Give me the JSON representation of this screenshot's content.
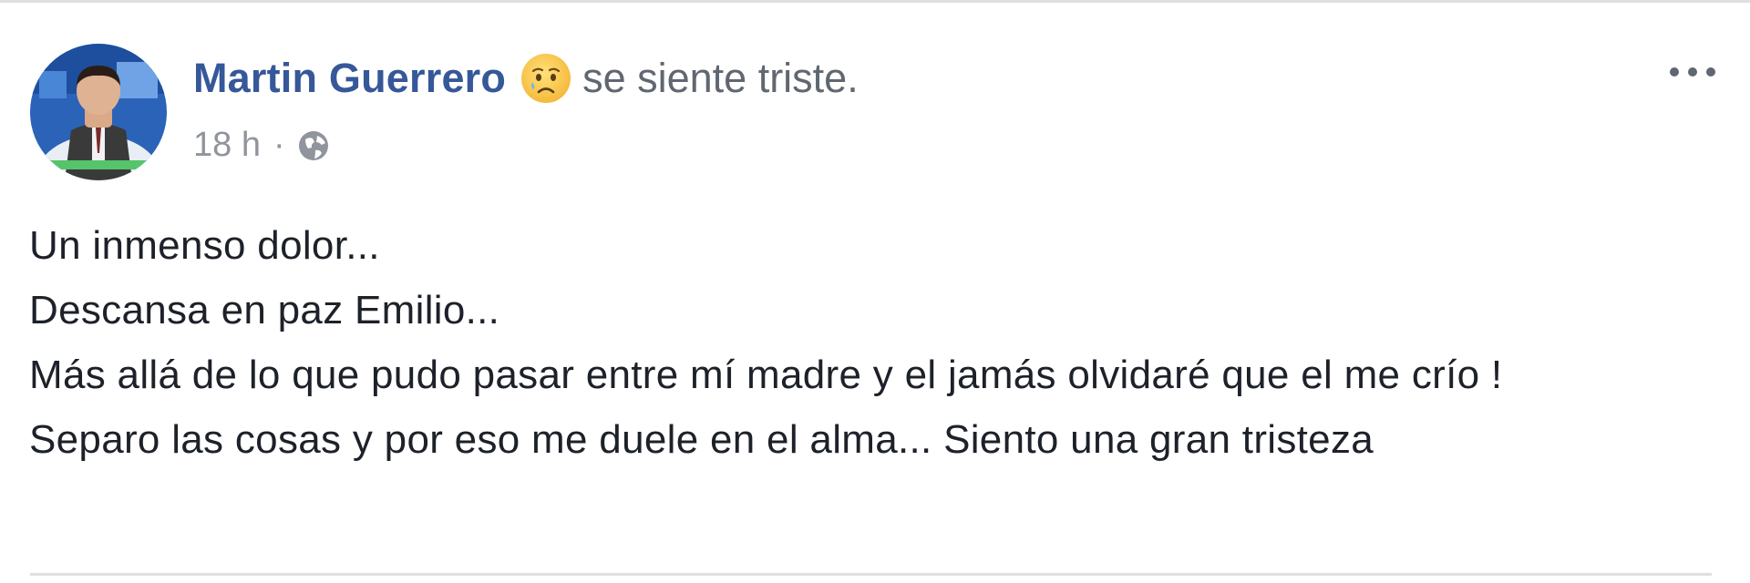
{
  "post": {
    "author_name": "Martin Guerrero",
    "feeling_icon": "sad-face-emoji",
    "feeling_text": "se siente triste.",
    "timestamp": "18 h",
    "meta_separator": "·",
    "privacy_icon": "globe-icon",
    "more_icon": "more-options-icon",
    "more_label": "•••",
    "lines": [
      "Un inmenso dolor...",
      "Descansa en paz Emilio...",
      "Más allá de lo que pudo pasar entre mí madre y el jamás olvidaré que el me crío !",
      "Separo las cosas y por eso me duele en el alma... Siento una gran tristeza"
    ]
  },
  "colors": {
    "author_link": "#365899",
    "secondary_text": "#606770",
    "meta_text": "#90949c",
    "body_text": "#1d2129",
    "divider": "#dddfe2"
  }
}
